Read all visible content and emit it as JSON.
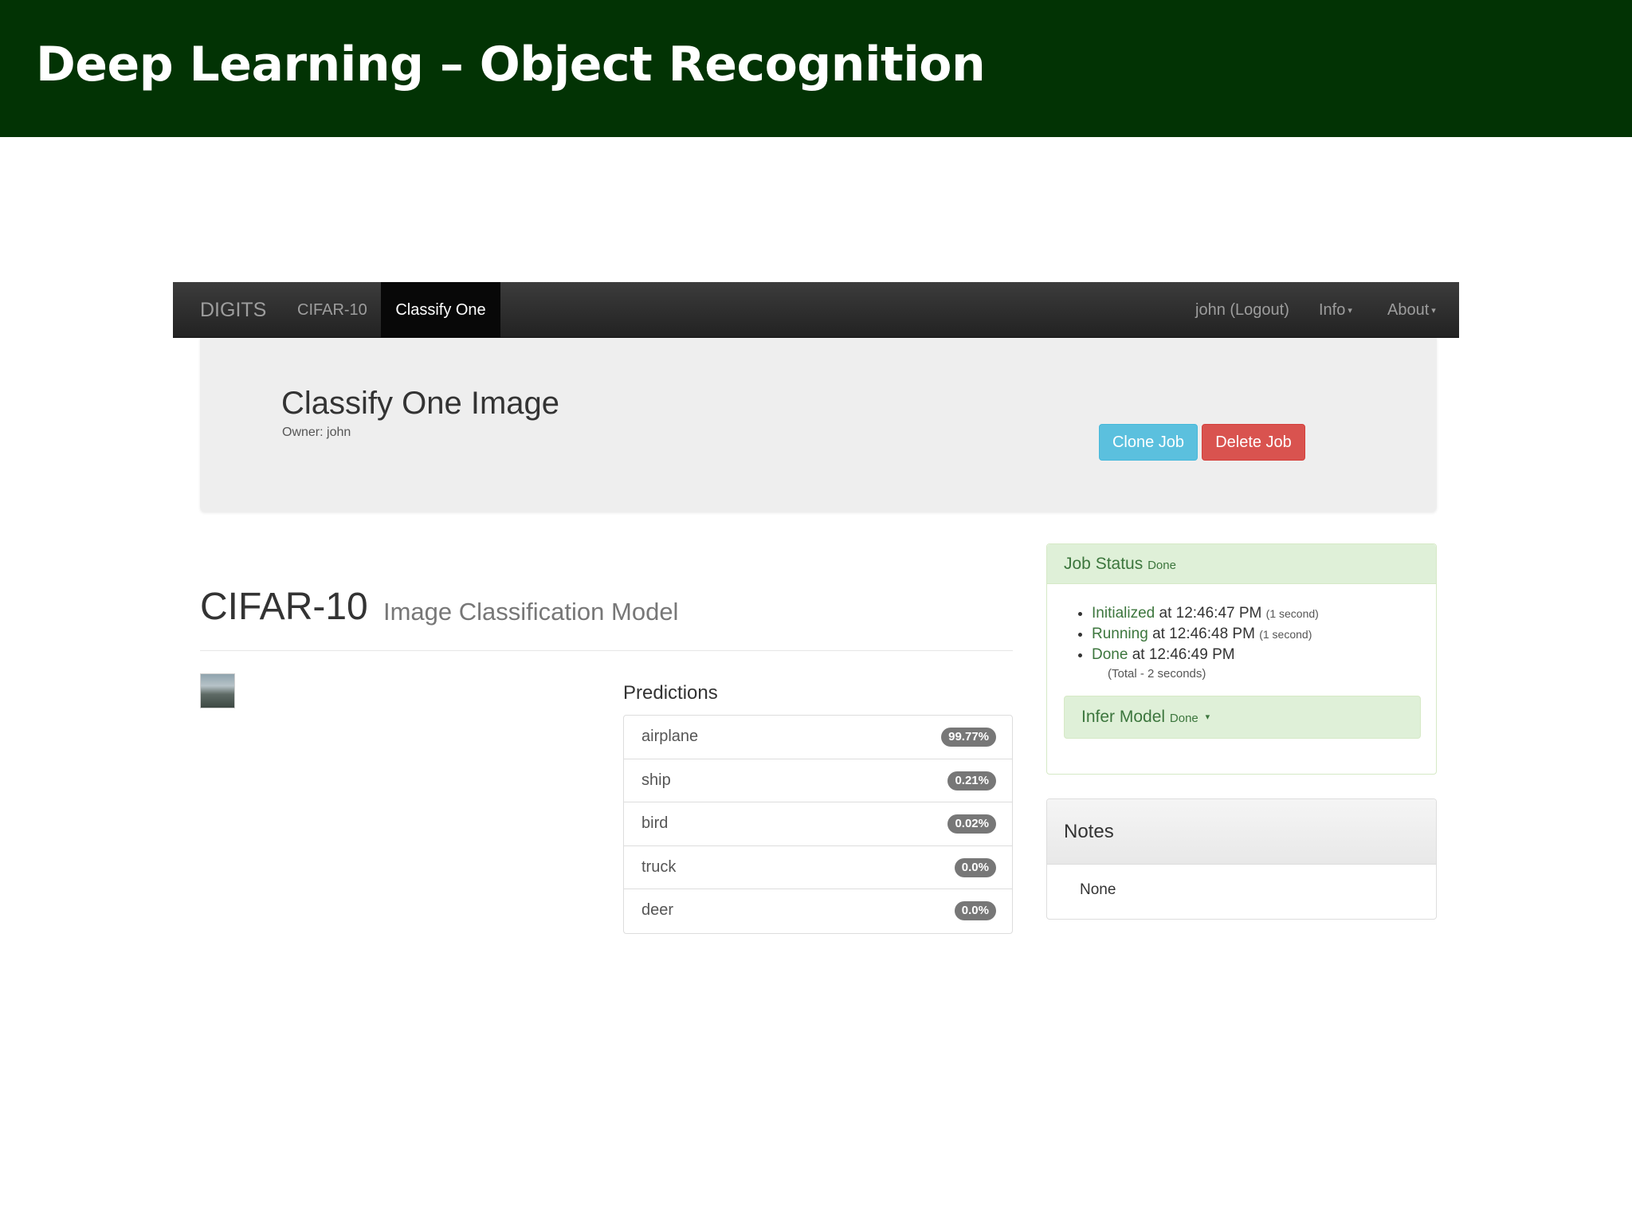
{
  "slide": {
    "title": "Deep Learning – Object Recognition"
  },
  "navbar": {
    "brand": "DIGITS",
    "items": [
      "CIFAR-10",
      "Classify One"
    ],
    "active_item": "Classify One",
    "user": "john (Logout)",
    "info": "Info",
    "about": "About"
  },
  "job": {
    "title": "Classify One Image",
    "owner": "Owner: john",
    "clone_label": "Clone Job",
    "delete_label": "Delete Job"
  },
  "model": {
    "name": "CIFAR-10",
    "subtitle": "Image Classification Model"
  },
  "predictions": {
    "label": "Predictions",
    "rows": [
      {
        "class": "airplane",
        "score": "99.77%"
      },
      {
        "class": "ship",
        "score": "0.21%"
      },
      {
        "class": "bird",
        "score": "0.02%"
      },
      {
        "class": "truck",
        "score": "0.0%"
      },
      {
        "class": "deer",
        "score": "0.0%"
      }
    ]
  },
  "job_status": {
    "heading": "Job Status",
    "state": "Done",
    "steps": [
      {
        "name": "Initialized",
        "at": "at 12:46:47 PM",
        "duration": "(1 second)"
      },
      {
        "name": "Running",
        "at": "at 12:46:48 PM",
        "duration": "(1 second)"
      },
      {
        "name": "Done",
        "at": "at 12:46:49 PM",
        "duration": ""
      }
    ],
    "total": "(Total - 2 seconds)",
    "infer_label": "Infer Model",
    "infer_state": "Done"
  },
  "notes": {
    "heading": "Notes",
    "body": "None"
  },
  "colors": {
    "slide_header": "#023304",
    "clone_button": "#5bc0de",
    "delete_button": "#d9534f",
    "success_panel": "#dff0d8",
    "badge": "#777777"
  },
  "icons": {
    "dropdown": "caret-down-icon",
    "test_image": "airplane-thumbnail"
  }
}
